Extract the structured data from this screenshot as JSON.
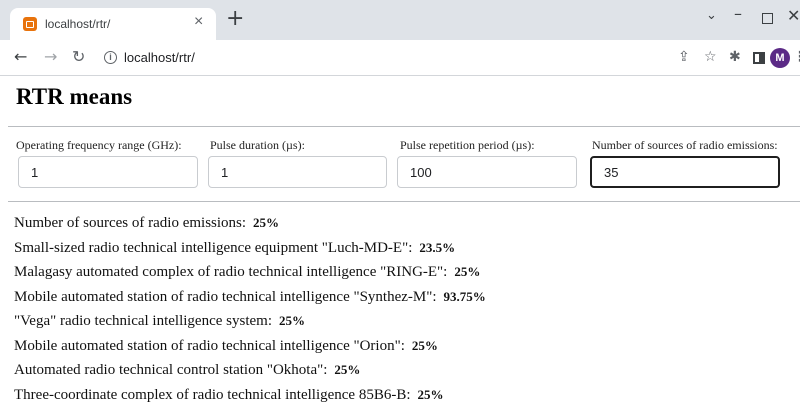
{
  "browser": {
    "tab_title": "localhost/rtr/",
    "tab_close": "×",
    "new_tab": "+",
    "url": "localhost/rtr/",
    "avatar_initial": "M",
    "controls": {
      "minimize": "–",
      "tab_search": "⌄",
      "close": "✕"
    }
  },
  "page": {
    "title": "RTR means",
    "fields": [
      {
        "label": "Operating frequency range (GHz):",
        "value": "1"
      },
      {
        "label": "Pulse duration (µs):",
        "value": "1"
      },
      {
        "label": "Pulse repetition period (µs):",
        "value": "100"
      },
      {
        "label": "Number of sources of radio emissions:",
        "value": "35"
      }
    ],
    "results": [
      {
        "label": "Number of sources of radio emissions:",
        "value": "25%"
      },
      {
        "label": "Small-sized radio technical intelligence equipment \"Luch-MD-E\":",
        "value": "23.5%"
      },
      {
        "label": "Malagasy automated complex of radio technical intelligence \"RING-E\":",
        "value": "25%"
      },
      {
        "label": "Mobile automated station of radio technical intelligence \"Synthez-M\":",
        "value": "93.75%"
      },
      {
        "label": "\"Vega\" radio technical intelligence system:",
        "value": "25%"
      },
      {
        "label": "Mobile automated station of radio technical intelligence \"Orion\":",
        "value": "25%"
      },
      {
        "label": "Automated radio technical control station \"Okhota\":",
        "value": "25%"
      },
      {
        "label": "Three-coordinate complex of radio technical intelligence 85B6-B:",
        "value": "25%"
      }
    ]
  }
}
